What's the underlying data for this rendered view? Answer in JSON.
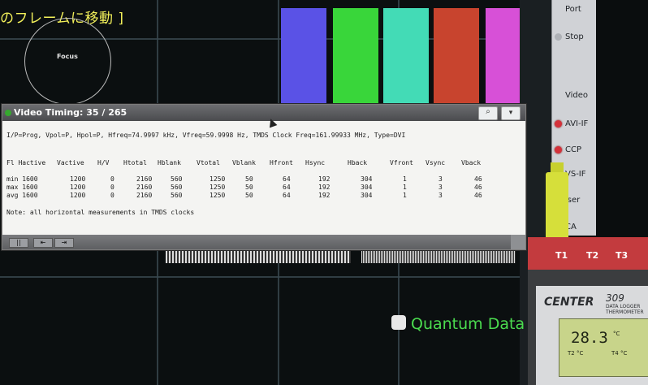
{
  "screen": {
    "title_fragment": "のフレームに移動 ]",
    "focus_label": "Focus",
    "brand_text": "Quantum Data",
    "color_bars": [
      "#5a52e6",
      "#39d63a",
      "#43dbb6",
      "#c8442e",
      "#d750d7",
      "#d7de32"
    ]
  },
  "side_panel": {
    "buttons": [
      {
        "label": "Port",
        "indicator": "none"
      },
      {
        "label": "Stop",
        "indicator": "grey"
      },
      {
        "label": "Video",
        "indicator": "none"
      },
      {
        "label": "AVI-IF",
        "indicator": "red"
      },
      {
        "label": "CCP",
        "indicator": "red"
      },
      {
        "label": "VS-IF",
        "indicator": "red"
      },
      {
        "label": "iser",
        "indicator": "none"
      },
      {
        "label": "CA",
        "indicator": "none"
      }
    ]
  },
  "video_timing": {
    "title": "Video Timing: 35 / 265",
    "summary": "I/P=Prog, Vpol=P, Hpol=P, Hfreq=74.9997 kHz, Vfreq=59.9998 Hz, TMDS Clock Freq=161.99933 MHz, Type=DVI",
    "columns": [
      "Fl Hactive",
      "Vactive",
      "H/V",
      "Htotal",
      "Hblank",
      "Vtotal",
      "Vblank",
      "Hfront",
      "Hsync",
      "Hback",
      "Vfront",
      "Vsync",
      "Vback"
    ],
    "rows": [
      [
        "min  1600",
        "1200",
        "0",
        "2160",
        "560",
        "1250",
        "50",
        "64",
        "192",
        "304",
        "1",
        "3",
        "46"
      ],
      [
        "max  1600",
        "1200",
        "0",
        "2160",
        "560",
        "1250",
        "50",
        "64",
        "192",
        "304",
        "1",
        "3",
        "46"
      ],
      [
        "avg  1600",
        "1200",
        "0",
        "2160",
        "560",
        "1250",
        "50",
        "64",
        "192",
        "304",
        "1",
        "3",
        "46"
      ]
    ],
    "note": "Note: all horizontal measurements in TMDS clocks",
    "footer_buttons": [
      "||",
      "⇤",
      "⇥"
    ]
  },
  "thermometer": {
    "probes": [
      "T1",
      "T2",
      "T3"
    ],
    "brand": "CENTER",
    "model": "309",
    "model_sub": "DATA LOGGER THERMOMETER",
    "reading": "28.3",
    "unit": "°C",
    "lcd_t2": "T2  °C",
    "lcd_t4": "T4  °C"
  }
}
